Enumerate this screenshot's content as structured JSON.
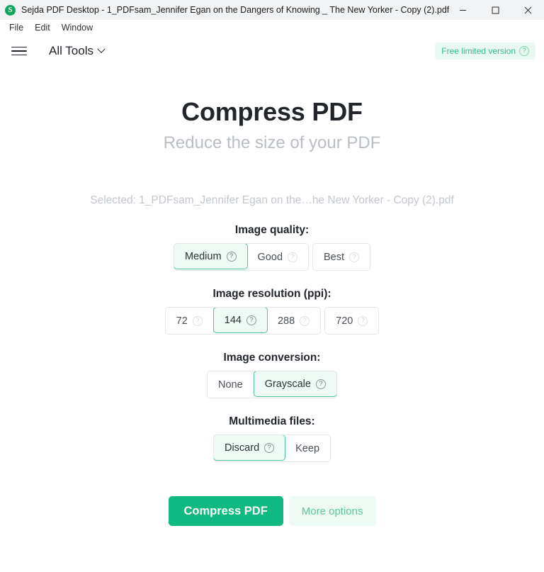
{
  "window": {
    "app_icon": "sejda-logo-icon",
    "title": "Sejda PDF Desktop - 1_PDFsam_Jennifer Egan on the Dangers of Knowing _ The New Yorker - Copy (2).pdf",
    "controls": {
      "minimize": "minimize-icon",
      "maximize": "maximize-icon",
      "close": "close-icon"
    }
  },
  "menubar": {
    "items": [
      {
        "label": "File"
      },
      {
        "label": "Edit"
      },
      {
        "label": "Window"
      }
    ]
  },
  "toolbar": {
    "menu_icon": "hamburger-icon",
    "all_tools_label": "All Tools",
    "chevron_icon": "chevron-down-icon",
    "badge_label": "Free limited version",
    "badge_help_icon": "help-circle-icon"
  },
  "main": {
    "title": "Compress PDF",
    "subtitle": "Reduce the size of your PDF",
    "selected_file": "Selected: 1_PDFsam_Jennifer Egan on the…he New Yorker - Copy (2).pdf"
  },
  "options": {
    "image_quality": {
      "label": "Image quality:",
      "groups": [
        {
          "items": [
            {
              "label": "Medium",
              "selected": true,
              "help": true
            },
            {
              "label": "Good",
              "selected": false,
              "help": true,
              "help_faded": true
            }
          ]
        },
        {
          "items": [
            {
              "label": "Best",
              "selected": false,
              "help": true,
              "help_faded": true
            }
          ]
        }
      ]
    },
    "image_resolution": {
      "label": "Image resolution (ppi):",
      "groups": [
        {
          "items": [
            {
              "label": "72",
              "selected": false,
              "help": true,
              "help_faded": true
            },
            {
              "label": "144",
              "selected": true,
              "help": true
            },
            {
              "label": "288",
              "selected": false,
              "help": true,
              "help_faded": true
            }
          ]
        },
        {
          "items": [
            {
              "label": "720",
              "selected": false,
              "help": true,
              "help_faded": true
            }
          ]
        }
      ]
    },
    "image_conversion": {
      "label": "Image conversion:",
      "groups": [
        {
          "items": [
            {
              "label": "None",
              "selected": false,
              "help": false
            },
            {
              "label": "Grayscale",
              "selected": true,
              "help": true
            }
          ]
        }
      ]
    },
    "multimedia_files": {
      "label": "Multimedia files:",
      "groups": [
        {
          "items": [
            {
              "label": "Discard",
              "selected": true,
              "help": true
            },
            {
              "label": "Keep",
              "selected": false,
              "help": false
            }
          ]
        }
      ]
    }
  },
  "actions": {
    "primary_label": "Compress PDF",
    "secondary_label": "More options"
  },
  "colors": {
    "accent_green": "#10b981",
    "selected_border": "#4fc39c",
    "selected_fill": "#effaf5",
    "badge_bg": "#e9f9f1",
    "badge_text": "#37b890",
    "titlebar_bg": "#f2f3f4"
  }
}
